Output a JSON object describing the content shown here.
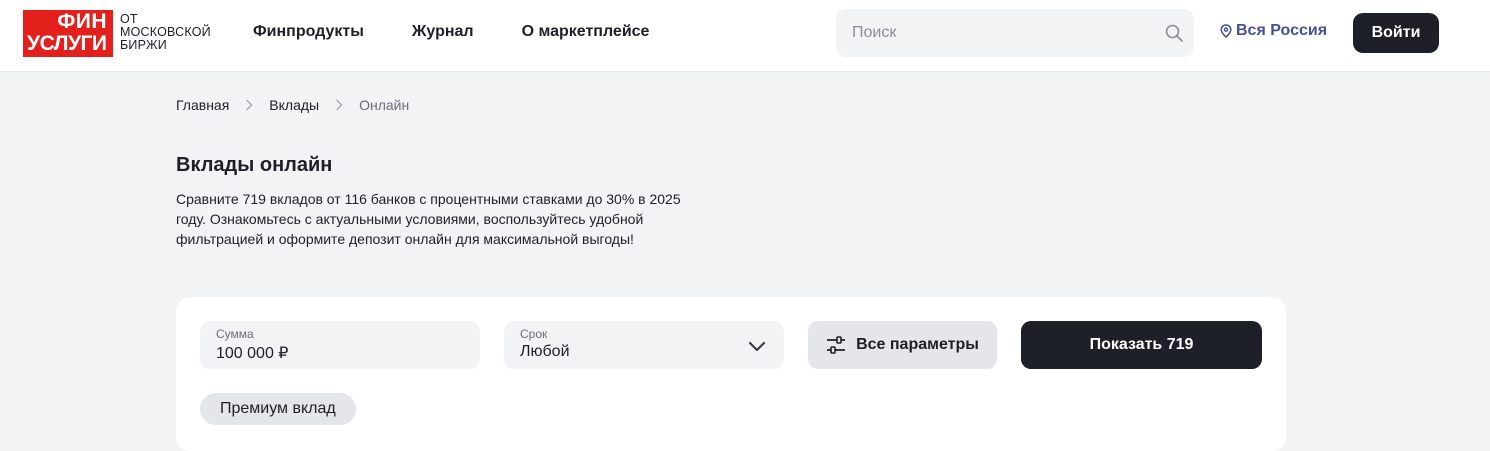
{
  "header": {
    "logo": {
      "line1": "ФИН",
      "line2": "УСЛУГИ",
      "sub": [
        "ОТ",
        "МОСКОВСКОЙ",
        "БИРЖИ"
      ]
    },
    "nav": [
      {
        "label": "Финпродукты"
      },
      {
        "label": "Журнал"
      },
      {
        "label": "О маркетплейсе"
      }
    ],
    "search": {
      "placeholder": "Поиск",
      "icon": "search-icon"
    },
    "region": {
      "label": "Вся Россия",
      "icon": "location-pin-icon"
    },
    "login_label": "Войти"
  },
  "breadcrumb": {
    "items": [
      {
        "label": "Главная"
      },
      {
        "label": "Вклады"
      },
      {
        "label": "Онлайн"
      }
    ]
  },
  "main": {
    "title": "Вклады онлайн",
    "description": "Сравните 719 вкладов от 116 банков с процентными ставками до 30% в 2025 году. Ознакомьтесь с актуальными условиями, воспользуйтесь удобной фильтрацией и оформите депозит онлайн для максимальной выгоды!"
  },
  "filters": {
    "amount": {
      "label": "Сумма",
      "value": "100 000 ₽"
    },
    "term": {
      "label": "Срок",
      "value": "Любой",
      "icon": "chevron-down-icon"
    },
    "params_button": {
      "label": "Все параметры",
      "icon": "sliders-icon"
    },
    "show_button": {
      "label": "Показать 719"
    },
    "chips": [
      {
        "label": "Премиум вклад"
      }
    ]
  },
  "colors": {
    "brand_red": "#e3201b",
    "dark": "#1d1f29",
    "region_link": "#46519b",
    "page_bg": "#f2f3f5"
  }
}
